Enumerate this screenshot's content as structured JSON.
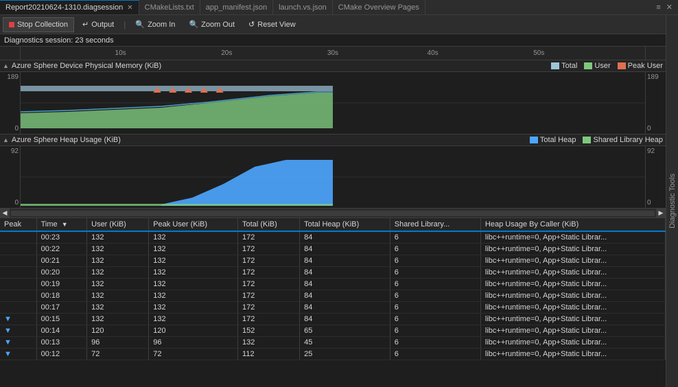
{
  "tabs": [
    {
      "id": "report",
      "label": "Report20210624-1310.diagsession",
      "active": true,
      "closable": true
    },
    {
      "id": "cmake",
      "label": "CMakeLists.txt",
      "active": false,
      "closable": false
    },
    {
      "id": "manifest",
      "label": "app_manifest.json",
      "active": false,
      "closable": false
    },
    {
      "id": "launch",
      "label": "launch.vs.json",
      "active": false,
      "closable": false
    },
    {
      "id": "cmake-overview",
      "label": "CMake Overview Pages",
      "active": false,
      "closable": false
    }
  ],
  "toolbar": {
    "stop_label": "Stop Collection",
    "output_label": "Output",
    "zoom_in_label": "Zoom In",
    "zoom_out_label": "Zoom Out",
    "reset_view_label": "Reset View"
  },
  "session": {
    "label": "Diagnostics session:",
    "duration": "23 seconds"
  },
  "sidebar": {
    "label": "Diagnostic Tools"
  },
  "timeline": {
    "marks": [
      "10s",
      "20s",
      "30s",
      "40s",
      "50s"
    ]
  },
  "charts": [
    {
      "id": "physical-memory",
      "title": "Azure Sphere Device Physical Memory (KiB)",
      "legend": [
        {
          "label": "Total",
          "color": "#9ec4d9"
        },
        {
          "label": "User",
          "color": "#7ec87e"
        },
        {
          "label": "Peak User",
          "color": "#e07050"
        }
      ],
      "y_max": "189",
      "y_min": "0"
    },
    {
      "id": "heap-usage",
      "title": "Azure Sphere Heap Usage (KiB)",
      "legend": [
        {
          "label": "Total Heap",
          "color": "#4da6ff"
        },
        {
          "label": "Shared Library Heap",
          "color": "#7ec87e"
        }
      ],
      "y_max": "92",
      "y_min": "0"
    }
  ],
  "table": {
    "columns": [
      {
        "id": "peak",
        "label": "Peak"
      },
      {
        "id": "time",
        "label": "Time",
        "sortable": true,
        "sort_dir": "desc"
      },
      {
        "id": "user",
        "label": "User (KiB)"
      },
      {
        "id": "peak_user",
        "label": "Peak User (KiB)"
      },
      {
        "id": "total",
        "label": "Total (KiB)"
      },
      {
        "id": "total_heap",
        "label": "Total Heap (KiB)"
      },
      {
        "id": "shared_library",
        "label": "Shared Library..."
      },
      {
        "id": "heap_by_caller",
        "label": "Heap Usage By Caller (KiB)"
      }
    ],
    "rows": [
      {
        "peak": "",
        "time": "00:23",
        "user": "132",
        "peak_user": "132",
        "total": "172",
        "total_heap": "84",
        "shared": "6",
        "heap_caller": "libc++runtime=0, App+Static Librar..."
      },
      {
        "peak": "",
        "time": "00:22",
        "user": "132",
        "peak_user": "132",
        "total": "172",
        "total_heap": "84",
        "shared": "6",
        "heap_caller": "libc++runtime=0, App+Static Librar..."
      },
      {
        "peak": "",
        "time": "00:21",
        "user": "132",
        "peak_user": "132",
        "total": "172",
        "total_heap": "84",
        "shared": "6",
        "heap_caller": "libc++runtime=0, App+Static Librar..."
      },
      {
        "peak": "",
        "time": "00:20",
        "user": "132",
        "peak_user": "132",
        "total": "172",
        "total_heap": "84",
        "shared": "6",
        "heap_caller": "libc++runtime=0, App+Static Librar..."
      },
      {
        "peak": "",
        "time": "00:19",
        "user": "132",
        "peak_user": "132",
        "total": "172",
        "total_heap": "84",
        "shared": "6",
        "heap_caller": "libc++runtime=0, App+Static Librar..."
      },
      {
        "peak": "",
        "time": "00:18",
        "user": "132",
        "peak_user": "132",
        "total": "172",
        "total_heap": "84",
        "shared": "6",
        "heap_caller": "libc++runtime=0, App+Static Librar..."
      },
      {
        "peak": "",
        "time": "00:17",
        "user": "132",
        "peak_user": "132",
        "total": "172",
        "total_heap": "84",
        "shared": "6",
        "heap_caller": "libc++runtime=0, App+Static Librar..."
      },
      {
        "peak": "▼",
        "time": "00:15",
        "user": "132",
        "peak_user": "132",
        "total": "172",
        "total_heap": "84",
        "shared": "6",
        "heap_caller": "libc++runtime=0, App+Static Librar..."
      },
      {
        "peak": "▼",
        "time": "00:14",
        "user": "120",
        "peak_user": "120",
        "total": "152",
        "total_heap": "65",
        "shared": "6",
        "heap_caller": "libc++runtime=0, App+Static Librar..."
      },
      {
        "peak": "▼",
        "time": "00:13",
        "user": "96",
        "peak_user": "96",
        "total": "132",
        "total_heap": "45",
        "shared": "6",
        "heap_caller": "libc++runtime=0, App+Static Librar..."
      },
      {
        "peak": "▼",
        "time": "00:12",
        "user": "72",
        "peak_user": "72",
        "total": "112",
        "total_heap": "25",
        "shared": "6",
        "heap_caller": "libc++runtime=0, App+Static Librar..."
      }
    ]
  }
}
